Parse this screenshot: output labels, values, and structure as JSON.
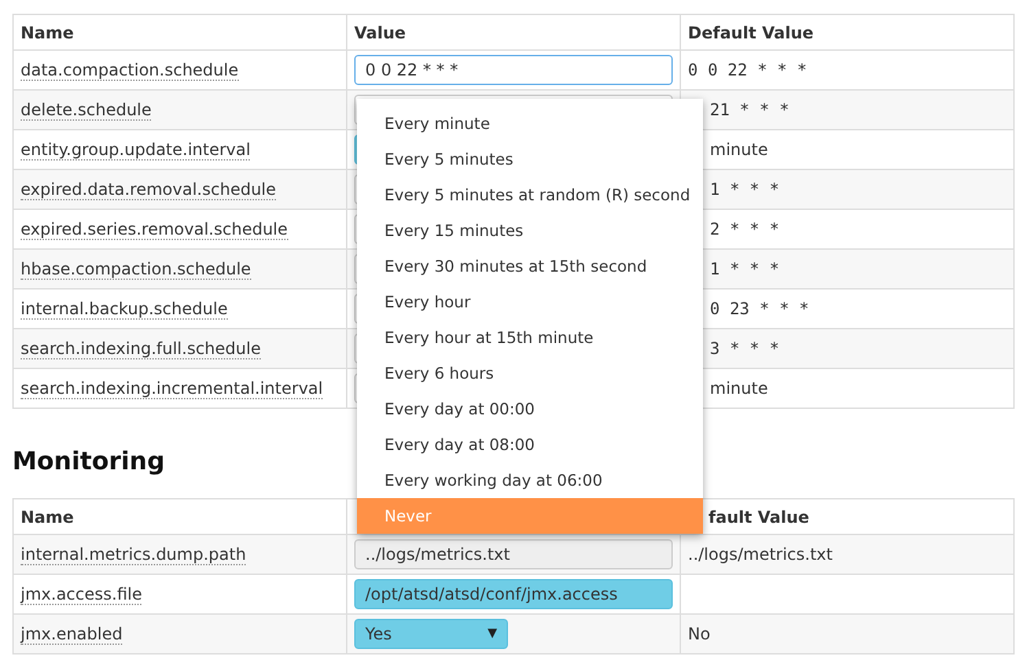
{
  "settings_table": {
    "columns": [
      "Name",
      "Value",
      "Default Value"
    ],
    "rows": [
      {
        "name": "data.compaction.schedule",
        "kind": "focused",
        "value": "0 0 22 * * *",
        "default": "0 0 22 * * *",
        "under_menu": false
      },
      {
        "name": "delete.schedule",
        "kind": "plain",
        "default": "21 * * *",
        "under_menu": true
      },
      {
        "name": "entity.group.update.interval",
        "kind": "highlighted",
        "default": "minute",
        "under_menu": true
      },
      {
        "name": "expired.data.removal.schedule",
        "kind": "plain",
        "default": "1 * * *",
        "under_menu": true
      },
      {
        "name": "expired.series.removal.schedule",
        "kind": "plain",
        "default": "2 * * *",
        "under_menu": true
      },
      {
        "name": "hbase.compaction.schedule",
        "kind": "plain",
        "default": "1 * * *",
        "under_menu": true
      },
      {
        "name": "internal.backup.schedule",
        "kind": "plain",
        "default": "0 23 * * *",
        "under_menu": true
      },
      {
        "name": "search.indexing.full.schedule",
        "kind": "plain",
        "default": "3 * * *",
        "under_menu": true
      },
      {
        "name": "search.indexing.incremental.interval",
        "kind": "plain",
        "default": "minute",
        "under_menu": true
      }
    ]
  },
  "schedule_menu": {
    "items": [
      {
        "label": "Every minute",
        "selected": false
      },
      {
        "label": "Every 5 minutes",
        "selected": false
      },
      {
        "label": "Every 5 minutes at random (R) second",
        "selected": false
      },
      {
        "label": "Every 15 minutes",
        "selected": false
      },
      {
        "label": "Every 30 minutes at 15th second",
        "selected": false
      },
      {
        "label": "Every hour",
        "selected": false
      },
      {
        "label": "Every hour at 15th minute",
        "selected": false
      },
      {
        "label": "Every 6 hours",
        "selected": false
      },
      {
        "label": "Every day at 00:00",
        "selected": false
      },
      {
        "label": "Every day at 08:00",
        "selected": false
      },
      {
        "label": "Every working day at 06:00",
        "selected": false
      },
      {
        "label": "Never",
        "selected": true
      }
    ]
  },
  "monitoring": {
    "heading": "Monitoring",
    "columns": [
      {
        "label": "Name",
        "under_menu": false
      },
      {
        "label": "fault Value",
        "under_menu": true
      }
    ],
    "rows": [
      {
        "name": "internal.metrics.dump.path",
        "kind": "disabled",
        "value": "../logs/metrics.txt",
        "default": "../logs/metrics.txt"
      },
      {
        "name": "jmx.access.file",
        "kind": "highlighted",
        "value": "/opt/atsd/atsd/conf/jmx.access"
      },
      {
        "name": "jmx.enabled",
        "kind": "select",
        "value": "Yes",
        "caret": "▼",
        "default": "No"
      }
    ]
  }
}
